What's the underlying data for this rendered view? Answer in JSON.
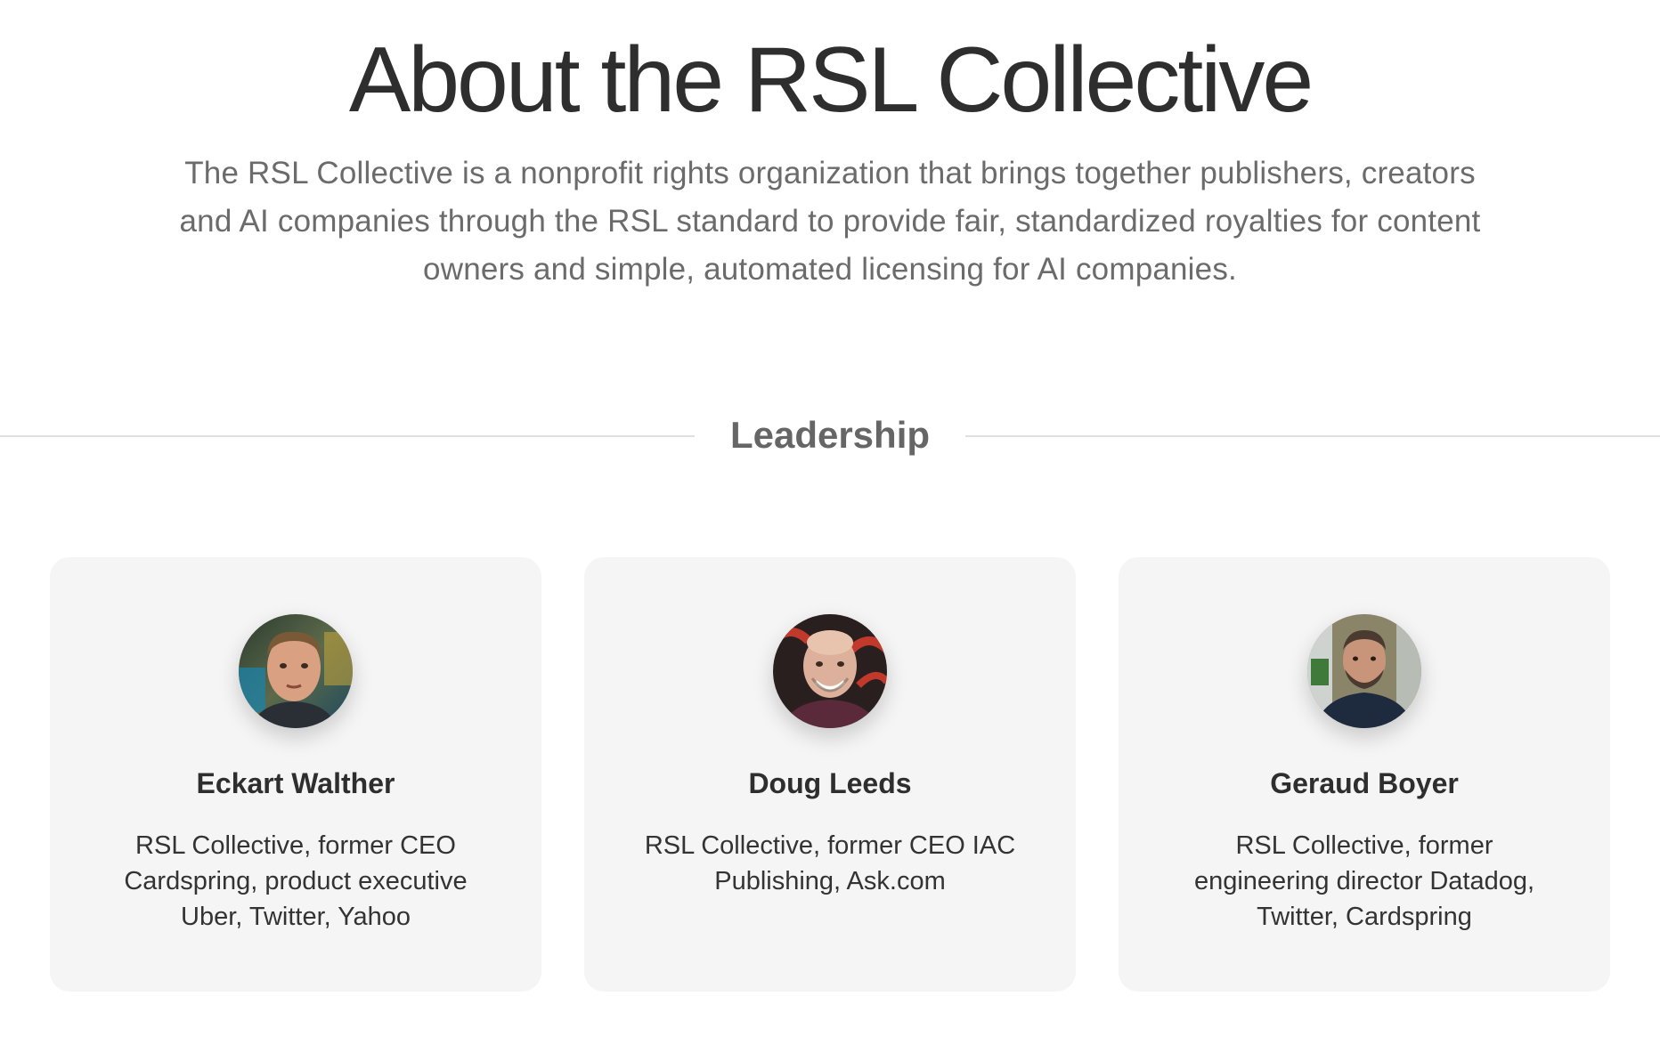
{
  "hero": {
    "title": "About the RSL Collective",
    "description": "The RSL Collective is a nonprofit rights organization that brings together publishers, creators and AI companies through the RSL standard to provide fair, standardized royalties for content owners and simple, automated licensing for AI companies."
  },
  "leadership": {
    "heading": "Leadership",
    "members": [
      {
        "name": "Eckart Walther",
        "bio": "RSL Collective, former CEO Cardspring, product executive Uber, Twitter, Yahoo",
        "avatar_icon": "person-photo"
      },
      {
        "name": "Doug Leeds",
        "bio": "RSL Collective, former CEO IAC Publishing, Ask.com",
        "avatar_icon": "person-photo"
      },
      {
        "name": "Geraud Boyer",
        "bio": "RSL Collective, former engineering director Datadog, Twitter, Cardspring",
        "avatar_icon": "person-photo"
      }
    ]
  },
  "colors": {
    "title": "#2e2e2e",
    "muted_text": "#6b6b6b",
    "card_background": "#f5f5f5",
    "divider": "#e0e0e0"
  }
}
